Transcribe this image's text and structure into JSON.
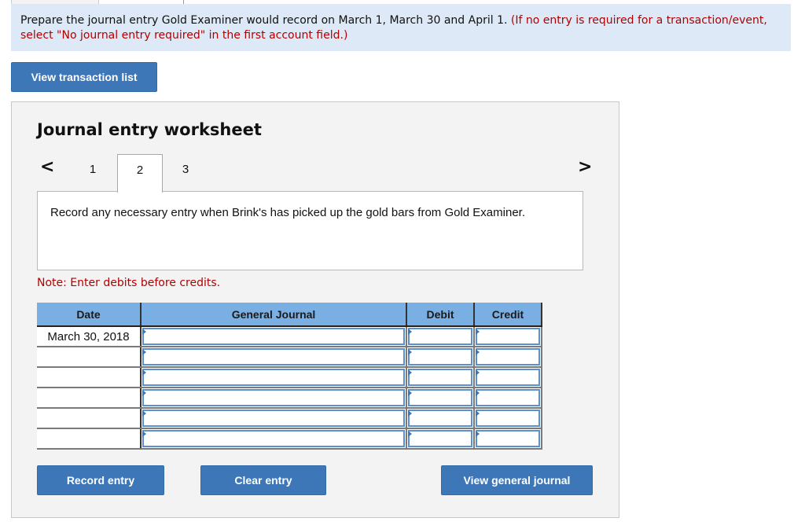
{
  "instructions": {
    "main_text": "Prepare the journal entry Gold Examiner would record on March 1, March 30 and April 1.",
    "red_text": "(If no entry is required for a transaction/event, select \"No journal entry required\" in the first account field.)"
  },
  "buttons": {
    "view_transaction_list": "View transaction list",
    "record_entry": "Record entry",
    "clear_entry": "Clear entry",
    "view_general_journal": "View general journal"
  },
  "worksheet": {
    "title": "Journal entry worksheet",
    "prev_icon": "chevron-left-icon",
    "next_icon": "chevron-right-icon",
    "prev_glyph": "<",
    "next_glyph": ">",
    "tabs": [
      {
        "label": "1",
        "active": false
      },
      {
        "label": "2",
        "active": true
      },
      {
        "label": "3",
        "active": false
      }
    ],
    "prompt": "Record any necessary entry when Brink's has picked up the gold bars from Gold Examiner.",
    "note": "Note: Enter debits before credits."
  },
  "journal": {
    "headers": [
      "Date",
      "General Journal",
      "Debit",
      "Credit"
    ],
    "rows": [
      {
        "date": "March 30, 2018",
        "account": "",
        "debit": "",
        "credit": ""
      },
      {
        "date": "",
        "account": "",
        "debit": "",
        "credit": ""
      },
      {
        "date": "",
        "account": "",
        "debit": "",
        "credit": ""
      },
      {
        "date": "",
        "account": "",
        "debit": "",
        "credit": ""
      },
      {
        "date": "",
        "account": "",
        "debit": "",
        "credit": ""
      },
      {
        "date": "",
        "account": "",
        "debit": "",
        "credit": ""
      }
    ]
  }
}
